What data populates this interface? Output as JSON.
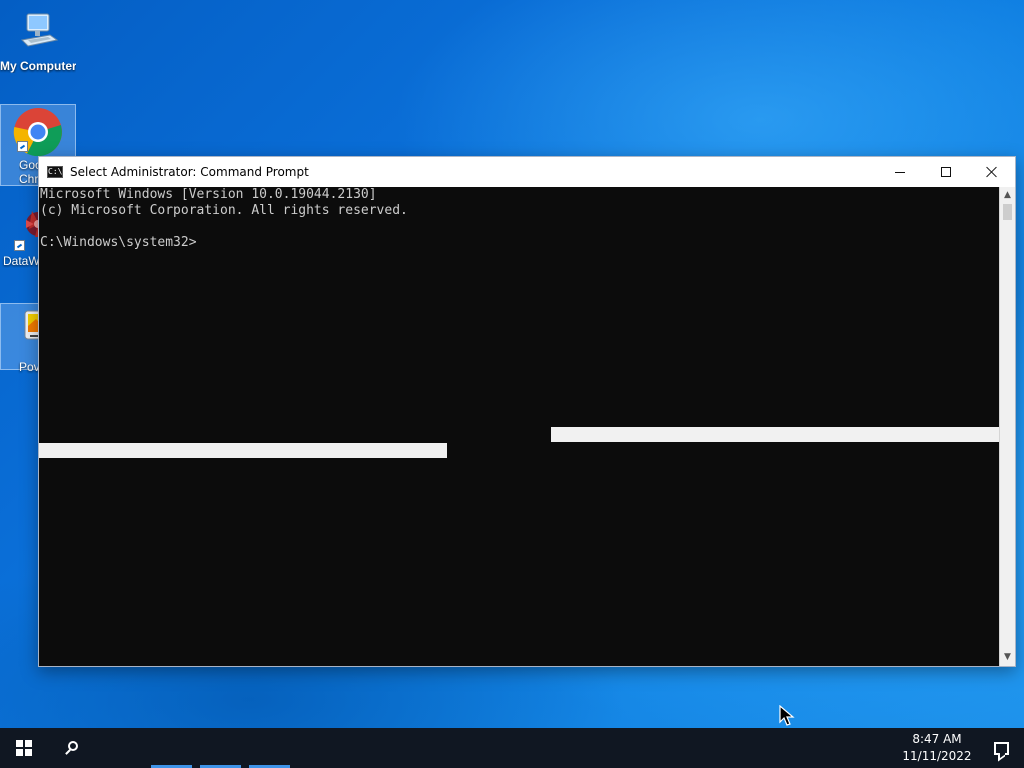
{
  "desktop": {
    "icons": [
      {
        "label": "My Computer",
        "icon": "computer-icon"
      },
      {
        "label": "Goo\nChr",
        "icon": "chrome-icon"
      },
      {
        "label": "DataW",
        "icon": "datawizard-icon"
      },
      {
        "label": "Pov",
        "icon": "pov-icon"
      }
    ]
  },
  "window": {
    "title": "Select Administrator: Command Prompt",
    "icon_label": "C:\\"
  },
  "console": {
    "lines": [
      "Microsoft Windows [Version 10.0.19044.2130]",
      "(c) Microsoft Corporation. All rights reserved.",
      "",
      "C:\\Windows\\system32>"
    ]
  },
  "taskbar": {
    "time": "8:47 AM",
    "date": "11/11/2022"
  },
  "colors": {
    "console_background": "#0c0c0c",
    "console_text": "#cccccc",
    "selection_highlight": "#f1f1f1",
    "taskbar": "#101722",
    "accent": "#3e93e8"
  }
}
